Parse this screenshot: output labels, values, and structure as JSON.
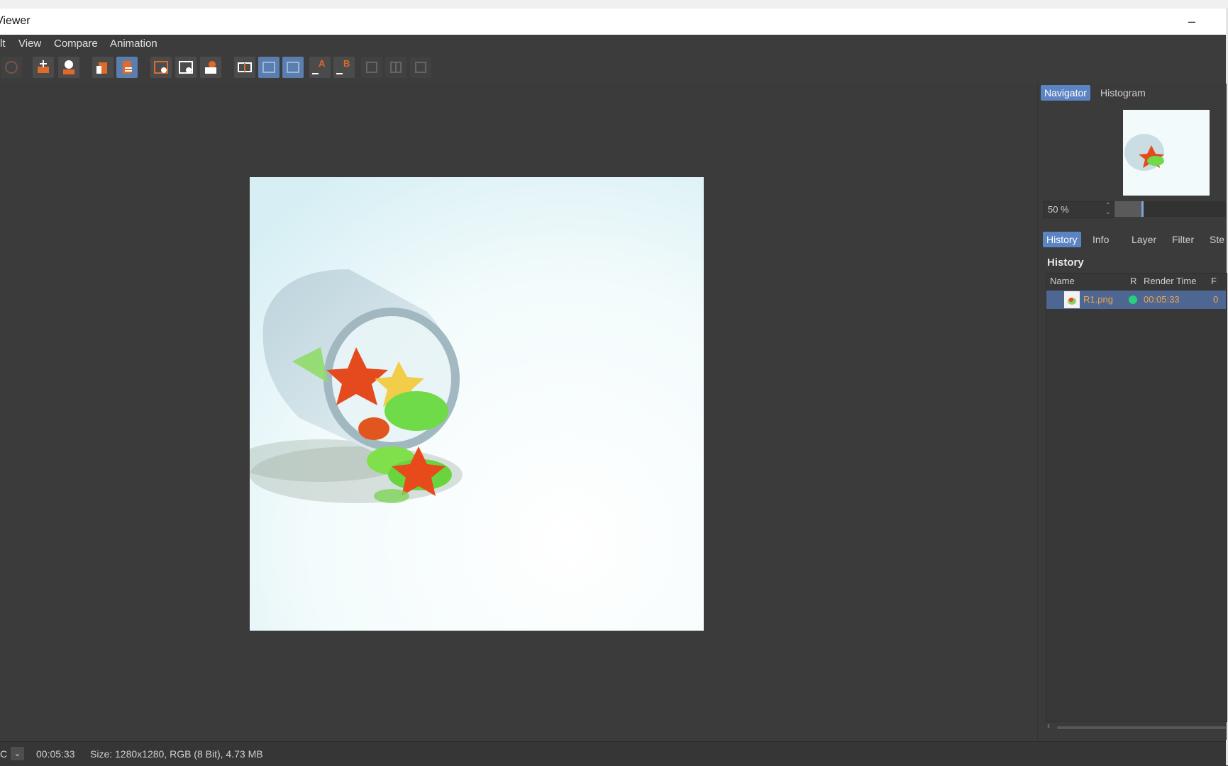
{
  "window": {
    "top_strip_text": "",
    "title": "Viewer",
    "minimize_glyph": "–"
  },
  "menu": [
    {
      "label": "lt"
    },
    {
      "label": "View"
    },
    {
      "label": "Compare"
    },
    {
      "label": "Animation"
    }
  ],
  "toolbar": {
    "buttons": [
      {
        "icon": "render-settings-icon",
        "state": "disabled"
      },
      {
        "icon": "move-icon",
        "state": "normal"
      },
      {
        "icon": "user-icon",
        "state": "normal"
      },
      {
        "icon": "export-icon",
        "state": "normal"
      },
      {
        "icon": "stack-icon",
        "state": "active"
      },
      {
        "icon": "view-region-icon",
        "state": "normal"
      },
      {
        "icon": "view-region-alt-icon",
        "state": "normal"
      },
      {
        "icon": "layers-render-icon",
        "state": "normal"
      },
      {
        "icon": "ab-compare-icon",
        "state": "normal"
      },
      {
        "icon": "split-horizontal-icon",
        "state": "active"
      },
      {
        "icon": "split-vertical-icon",
        "state": "active"
      },
      {
        "icon": "set-a-icon",
        "state": "normal"
      },
      {
        "icon": "set-b-icon",
        "state": "normal"
      },
      {
        "icon": "fit-icon",
        "state": "disabled"
      },
      {
        "icon": "side-by-side-icon",
        "state": "disabled"
      },
      {
        "icon": "swap-icon",
        "state": "disabled"
      }
    ],
    "labels": {
      "a": "A",
      "b": "B"
    }
  },
  "navigator": {
    "tabs": [
      "Navigator",
      "Histogram"
    ],
    "selected_tab": "Navigator",
    "zoom": "50 %",
    "zoom_fraction": 0.24
  },
  "history": {
    "tabs": [
      "History",
      "Info",
      "Layer",
      "Filter",
      "Ste"
    ],
    "selected_tab": "History",
    "heading": "History",
    "columns": [
      "Name",
      "R",
      "Render Time",
      "F"
    ],
    "rows": [
      {
        "name": "R1.png",
        "status_color": "#27d07a",
        "render_time": "00:05:33",
        "frame": "0"
      }
    ],
    "scroll_left_glyph": "‹"
  },
  "status": {
    "left_glyph": "C",
    "dropdown_glyph": "⌄",
    "time": "00:05:33",
    "info": "Size: 1280x1280, RGB (8 Bit), 4.73 MB"
  },
  "colors": {
    "accent": "#5b84c2",
    "selection_row": "#4d6792",
    "highlight_text": "#f0a44a"
  }
}
